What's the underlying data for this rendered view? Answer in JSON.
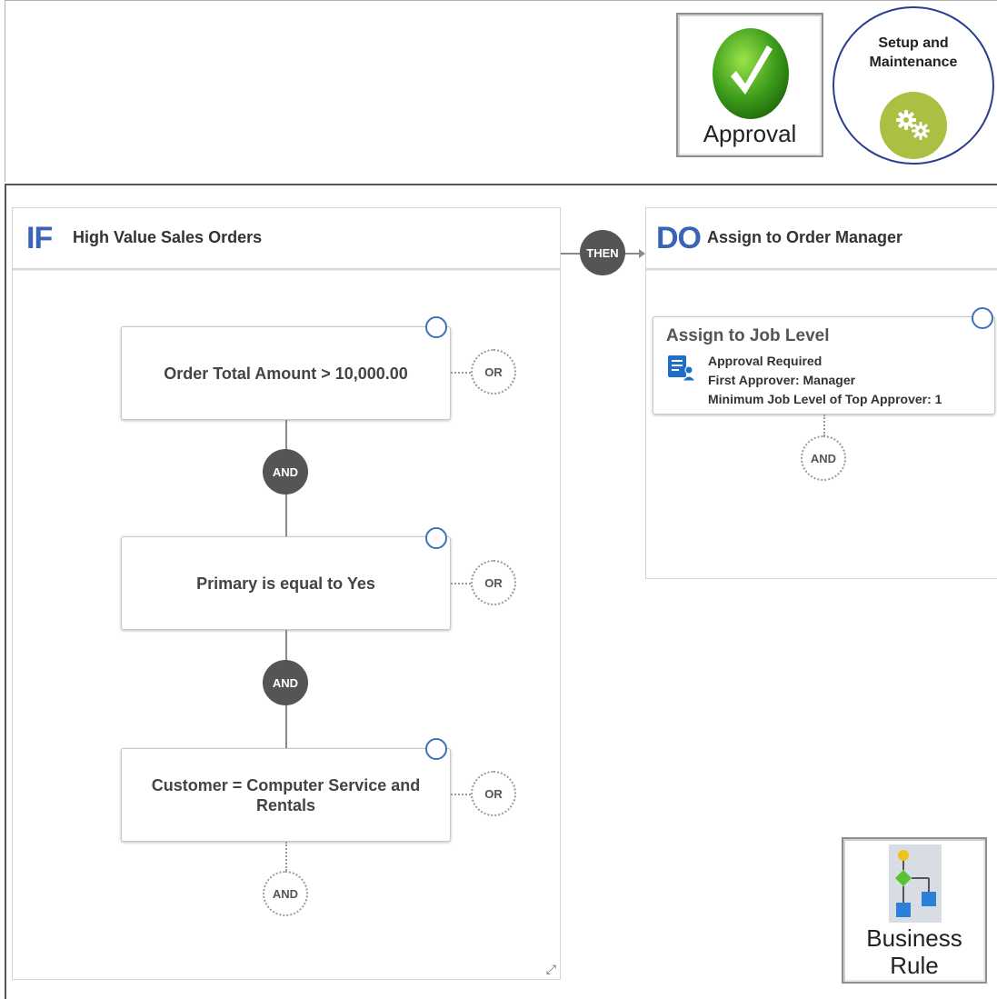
{
  "tiles": {
    "approval_label": "Approval",
    "setup_title_line1": "Setup and",
    "setup_title_line2": "Maintenance",
    "business_rule_line1": "Business",
    "business_rule_line2": "Rule"
  },
  "if_panel": {
    "keyword": "IF",
    "title": "High Value Sales Orders",
    "conditions": [
      {
        "text": "Order Total Amount > 10,000.00",
        "or_label": "OR"
      },
      {
        "text": "Primary is equal to Yes",
        "or_label": "OR"
      },
      {
        "text": "Customer = Computer Service and Rentals",
        "or_label": "OR"
      }
    ],
    "and_connectors": [
      "AND",
      "AND"
    ],
    "add_and_label": "AND"
  },
  "then_label": "THEN",
  "do_panel": {
    "keyword": "DO",
    "title": "Assign to Order Manager",
    "action": {
      "title": "Assign to Job Level",
      "lines": [
        "Approval Required",
        "First Approver: Manager",
        "Minimum Job Level of Top Approver: 1"
      ]
    },
    "add_and_label": "AND"
  },
  "icons": {
    "approval": "green-check-icon",
    "setup": "gears-icon",
    "business_rule": "flowchart-icon",
    "action": "document-user-icon",
    "resize": "resize-arrow-icon"
  },
  "colors": {
    "keyword_blue": "#3a63b8",
    "connector_dark": "#555555",
    "gear_green": "#a9c043",
    "setup_border": "#2c3e91"
  }
}
